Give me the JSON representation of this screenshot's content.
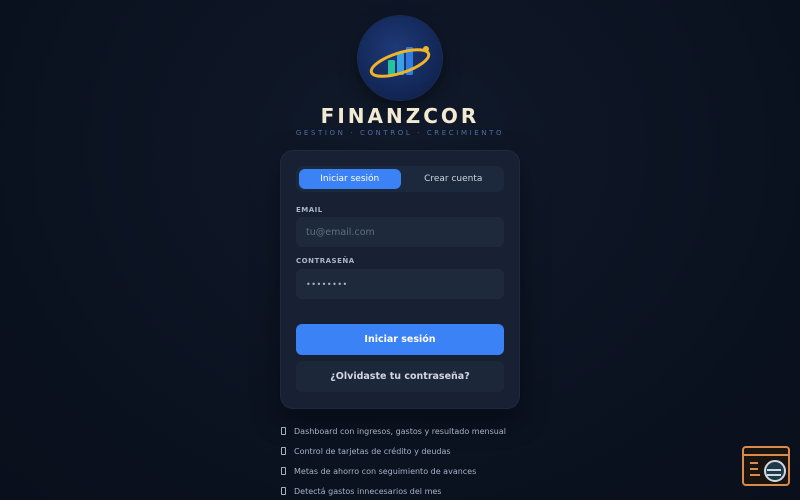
{
  "brand": {
    "name": "FINANZCOR",
    "tagline": "GESTION · CONTROL · CRECIMIENTO",
    "logo_icon": "bar-chart-orbit-icon"
  },
  "auth": {
    "tabs": [
      {
        "label": "Iniciar sesión",
        "active": true
      },
      {
        "label": "Crear cuenta",
        "active": false
      }
    ],
    "email": {
      "label": "EMAIL",
      "placeholder": "tu@email.com",
      "value": ""
    },
    "password": {
      "label": "CONTRASEÑA",
      "value": "••••••••"
    },
    "submit_label": "Iniciar sesión",
    "forgot_label": "¿Olvidaste tu contraseña?"
  },
  "features": [
    "Dashboard con ingresos, gastos y resultado mensual",
    "Control de tarjetas de crédito y deudas",
    "Metas de ahorro con seguimiento de avances",
    "Detectá gastos innecesarios del mes"
  ],
  "colors": {
    "accent": "#3b82f6",
    "background": "#0b1220",
    "card": "#172133",
    "brand_text": "#f3ead2"
  }
}
